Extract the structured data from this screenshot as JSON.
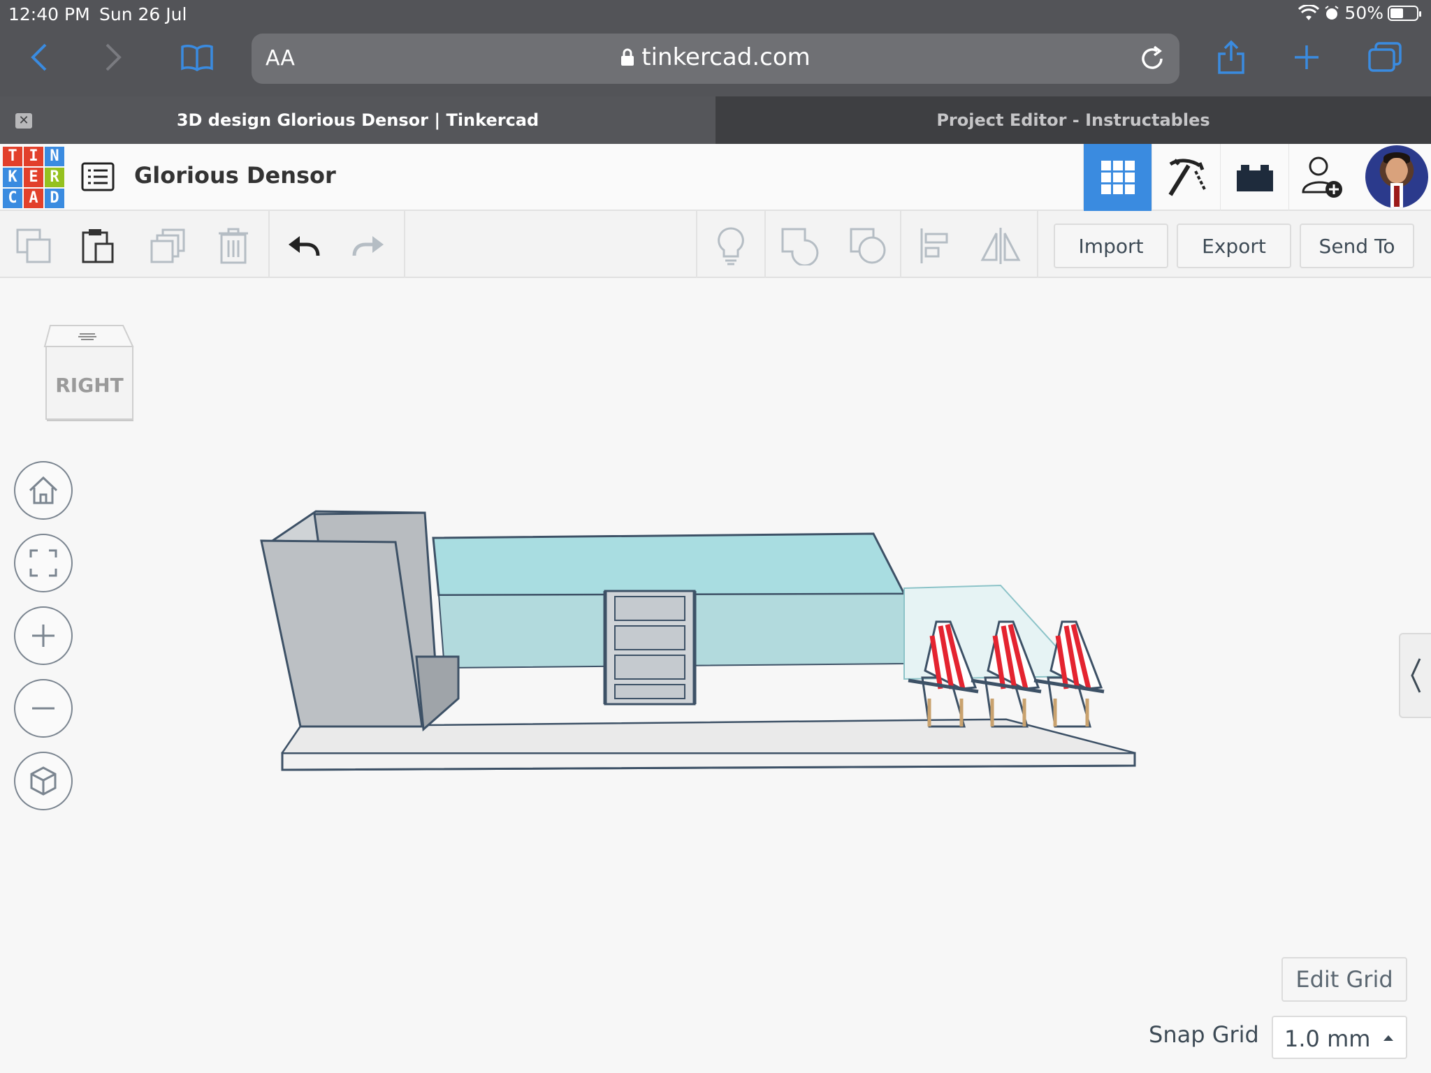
{
  "status_bar": {
    "time": "12:40 PM",
    "date": "Sun 26 Jul",
    "battery": "50%",
    "battery_level": 0.5
  },
  "browser": {
    "aa_label": "AA",
    "url": "tinkercad.com",
    "tabs": [
      {
        "title": "3D design Glorious Densor | Tinkercad",
        "active": true
      },
      {
        "title": "Project Editor - Instructables",
        "active": false
      }
    ]
  },
  "app": {
    "logo_letters": [
      "T",
      "I",
      "N",
      "K",
      "E",
      "R",
      "C",
      "A",
      "D"
    ],
    "logo_colors": [
      "#e2402b",
      "#e2402b",
      "#3a8be0",
      "#3a8be0",
      "#e2402b",
      "#95c11f",
      "#3a8be0",
      "#e2402b",
      "#3a8be0"
    ],
    "design_title": "Glorious Densor",
    "accent": "#3a8be0"
  },
  "toolbar": {
    "import_label": "Import",
    "export_label": "Export",
    "send_to_label": "Send To"
  },
  "viewcube": {
    "face_label": "RIGHT"
  },
  "grid": {
    "edit_grid_label": "Edit Grid",
    "snap_grid_label": "Snap Grid",
    "snap_value": "1.0 mm"
  }
}
